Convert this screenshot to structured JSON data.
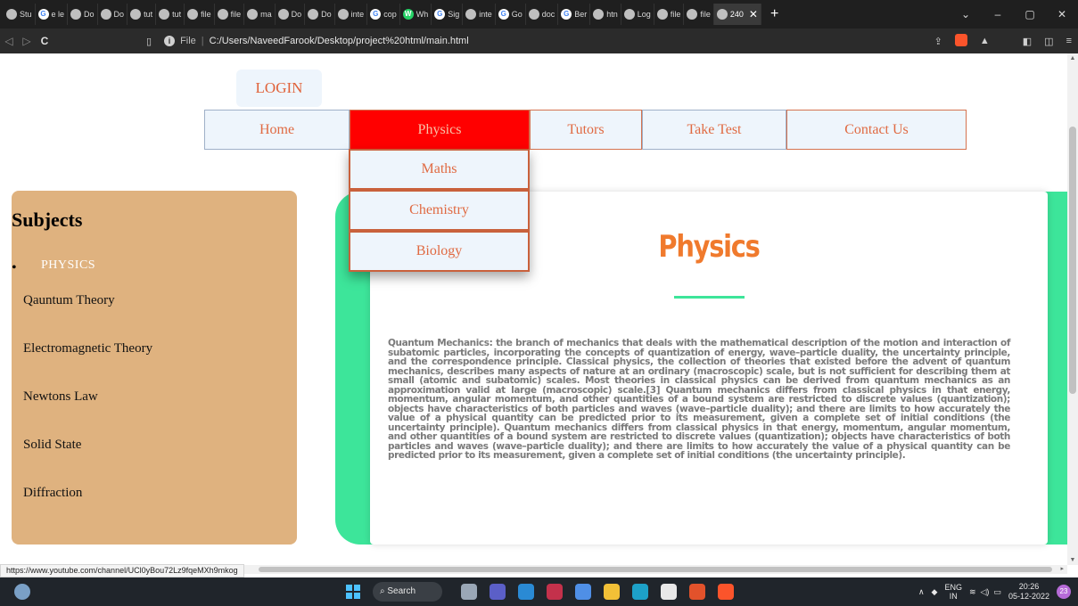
{
  "browser": {
    "tabs": [
      {
        "label": "Stu",
        "icon": "globe-icon"
      },
      {
        "label": "e le",
        "icon": "google-icon"
      },
      {
        "label": "Do",
        "icon": "globe-icon"
      },
      {
        "label": "Do",
        "icon": "globe-icon"
      },
      {
        "label": "tut",
        "icon": "globe-icon"
      },
      {
        "label": "tut",
        "icon": "globe-icon"
      },
      {
        "label": "file",
        "icon": "globe-icon"
      },
      {
        "label": "file",
        "icon": "globe-icon"
      },
      {
        "label": "ma",
        "icon": "globe-icon"
      },
      {
        "label": "Do",
        "icon": "globe-icon"
      },
      {
        "label": "Do",
        "icon": "globe-icon"
      },
      {
        "label": "inte",
        "icon": "globe-icon"
      },
      {
        "label": "cop",
        "icon": "google-icon"
      },
      {
        "label": "Wh",
        "icon": "whatsapp-icon"
      },
      {
        "label": "Sig",
        "icon": "google-icon"
      },
      {
        "label": "inte",
        "icon": "globe-icon"
      },
      {
        "label": "Go",
        "icon": "google-icon"
      },
      {
        "label": "doc",
        "icon": "globe-icon"
      },
      {
        "label": "Ber",
        "icon": "google-icon"
      },
      {
        "label": "htn",
        "icon": "globe-icon"
      },
      {
        "label": "Log",
        "icon": "globe-icon"
      },
      {
        "label": "file",
        "icon": "globe-icon"
      },
      {
        "label": "file",
        "icon": "globe-icon"
      },
      {
        "label": "240",
        "icon": "globe-icon"
      }
    ],
    "active_tab_close": "✕",
    "new_tab": "+",
    "url_protocol": "File",
    "url": "C:/Users/NaveedFarook/Desktop/project%20html/main.html",
    "status_link": "https://www.youtube.com/channel/UCl0yBou72Lz9fqeMXh9mkog"
  },
  "page": {
    "login_label": "LOGIN",
    "nav": {
      "home": "Home",
      "physics": "Physics",
      "tutors": "Tutors",
      "take_test": "Take Test",
      "contact_us": "Contact Us"
    },
    "dropdown": {
      "maths": "Maths",
      "chemistry": "Chemistry",
      "biology": "Biology"
    },
    "sidebar": {
      "title": "Subjects",
      "current": "PHYSICS",
      "links": [
        "Qauntum Theory",
        "Electromagnetic Theory",
        "Newtons Law",
        "Solid State",
        "Diffraction"
      ]
    },
    "content": {
      "title": "Physics",
      "body": "Quantum Mechanics: the branch of mechanics that deals with the mathematical description of the motion and interaction of subatomic particles, incorporating the concepts of quantization of energy, wave–particle duality, the uncertainty principle, and the correspondence principle. Classical physics, the collection of theories that existed before the advent of quantum mechanics, describes many aspects of nature at an ordinary (macroscopic) scale, but is not sufficient for describing them at small (atomic and subatomic) scales. Most theories in classical physics can be derived from quantum mechanics as an approximation valid at large (macroscopic) scale.[3] Quantum mechanics differs from classical physics in that energy, momentum, angular momentum, and other quantities of a bound system are restricted to discrete values (quantization); objects have characteristics of both particles and waves (wave–particle duality); and there are limits to how accurately the value of a physical quantity can be predicted prior to its measurement, given a complete set of initial conditions (the uncertainty principle). Quantum mechanics differs from classical physics in that energy, momentum, angular momentum, and other quantities of a bound system are restricted to discrete values (quantization); objects have characteristics of both particles and waves (wave–particle duality); and there are limits to how accurately the value of a physical quantity can be predicted prior to its measurement, given a complete set of initial conditions (the uncertainty principle)."
    }
  },
  "taskbar": {
    "search_label": "Search",
    "lang_top": "ENG",
    "lang_bottom": "IN",
    "time": "20:26",
    "date": "05-12-2022",
    "notification_count": "23"
  },
  "colors": {
    "nav_active": "#ff0000",
    "sidebar_bg": "#dfb27f",
    "accent_green": "#3de59a",
    "title_orange": "#f07a2d"
  }
}
